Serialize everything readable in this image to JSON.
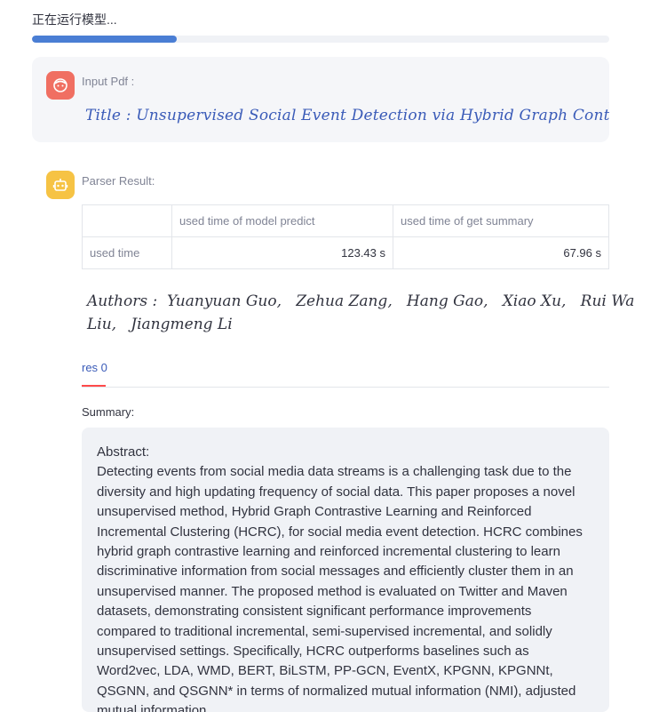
{
  "status": {
    "text": "正在运行模型...",
    "progress": 0.25,
    "accent_color": "#4a7ed4"
  },
  "input_message": {
    "label": "Input Pdf :",
    "avatar_icon": "smile-face-icon",
    "title_line": "Title :  Unsupervised Social Event Detection via Hybrid Graph Contrastive"
  },
  "parser_message": {
    "label": "Parser Result:",
    "avatar_icon": "robot-icon",
    "table": {
      "headers": [
        "",
        "used time of model predict",
        "used time of get summary"
      ],
      "rows": [
        [
          "used time",
          "123.43 s",
          "67.96 s"
        ]
      ]
    },
    "authors_line1": "Authors :  Yuanyuan Guo,   Zehua Zang,   Hang Gao,   Xiao Xu,   Rui Wa",
    "authors_line2": "Liu,   Jiangmeng Li",
    "tab_label": "res 0",
    "summary_label": "Summary:",
    "summary_heading": "Abstract:",
    "summary_body": "Detecting events from social media data streams is a challenging task due to the diversity and high updating frequency of social data. This paper proposes a novel unsupervised method, Hybrid Graph Contrastive Learning and Reinforced Incremental Clustering (HCRC), for social media event detection. HCRC combines hybrid graph contrastive learning and reinforced incremental clustering to learn discriminative information from social messages and efficiently cluster them in an unsupervised manner. The proposed method is evaluated on Twitter and Maven datasets, demonstrating consistent significant performance improvements compared to traditional incremental, semi-supervised incremental, and solidly unsupervised settings. Specifically, HCRC outperforms baselines such as Word2vec, LDA, WMD, BERT, BiLSTM, PP-GCN, EventX, KPGNN, KPGNNt, QSGNN, and QSGNN* in terms of normalized mutual information (NMI), adjusted mutual information"
  }
}
